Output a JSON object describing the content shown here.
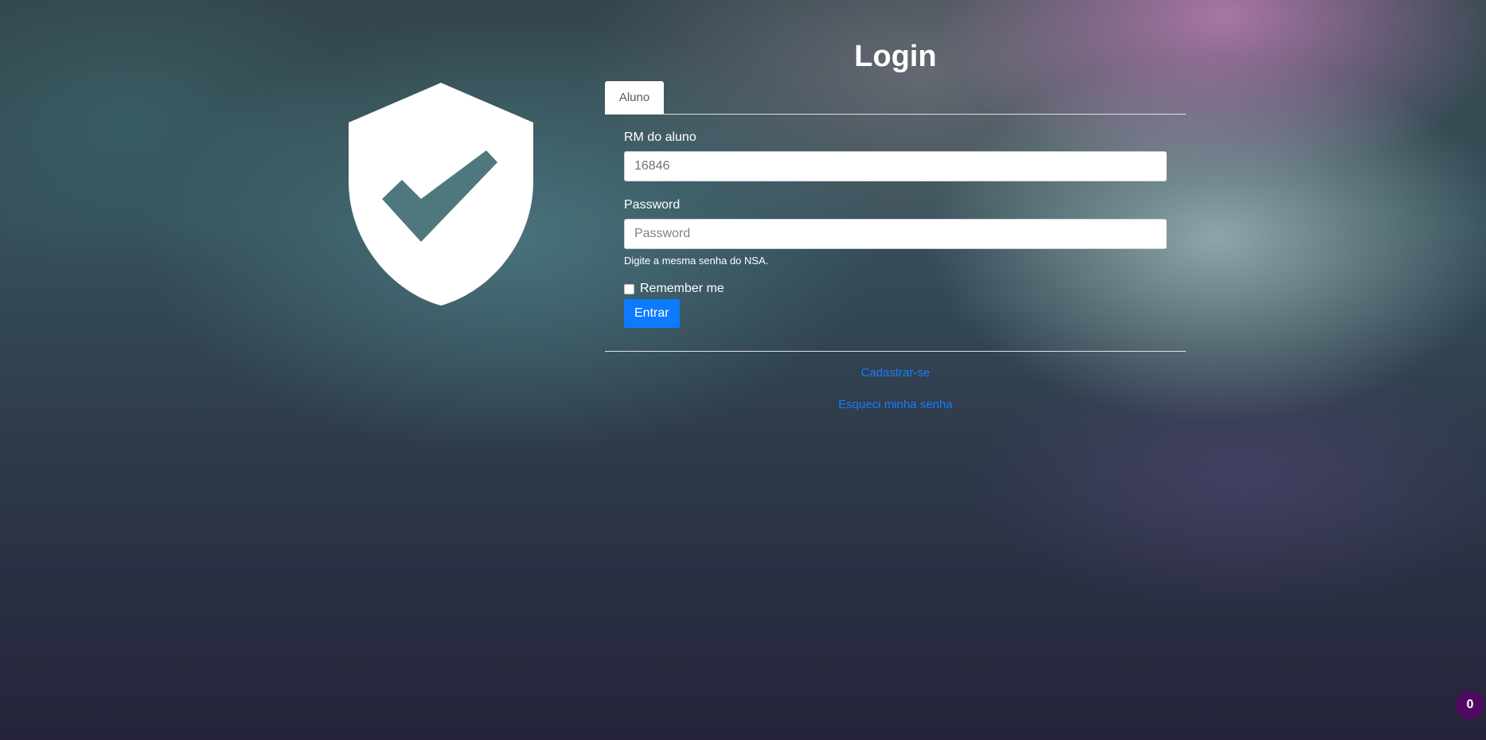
{
  "page": {
    "title": "Login"
  },
  "hero": {
    "icon": "shield-check-icon"
  },
  "tabs": [
    {
      "label": "Aluno",
      "active": true
    }
  ],
  "form": {
    "rm_label": "RM do aluno",
    "rm_value": "16846",
    "password_label": "Password",
    "password_placeholder": "Password",
    "password_help": "Digite a mesma senha do NSA.",
    "remember_label": "Remember me",
    "remember_checked": false,
    "submit_label": "Entrar"
  },
  "links": {
    "register": "Cadastrar-se",
    "forgot_password": "Esqueci minha senha"
  },
  "badge": {
    "count": "0"
  },
  "colors": {
    "primary": "#0d7bff",
    "link": "#1a7bff",
    "badge": "#4f0a60"
  }
}
